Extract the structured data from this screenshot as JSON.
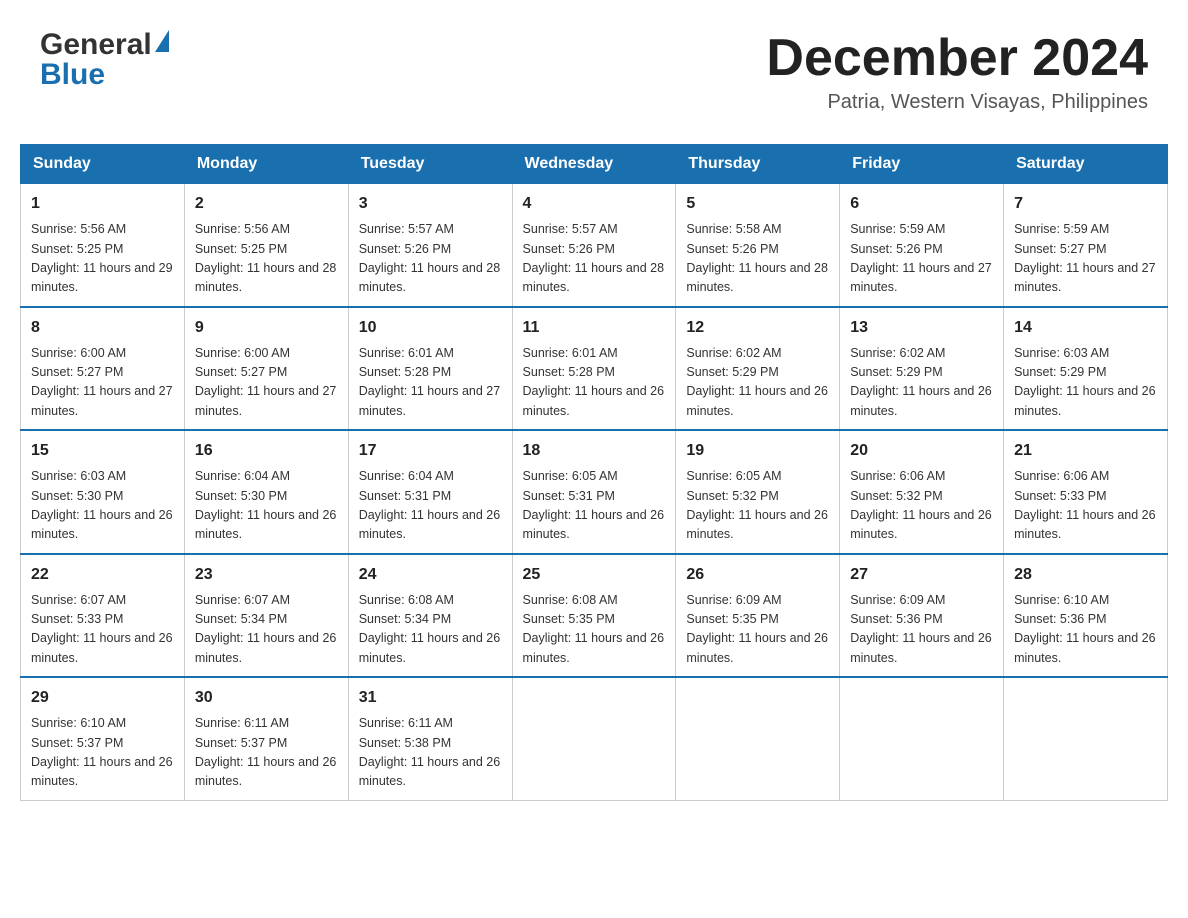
{
  "header": {
    "logo": {
      "general": "General",
      "blue": "Blue"
    },
    "title": "December 2024",
    "location": "Patria, Western Visayas, Philippines"
  },
  "calendar": {
    "days_of_week": [
      "Sunday",
      "Monday",
      "Tuesday",
      "Wednesday",
      "Thursday",
      "Friday",
      "Saturday"
    ],
    "weeks": [
      [
        {
          "day": "1",
          "sunrise": "Sunrise: 5:56 AM",
          "sunset": "Sunset: 5:25 PM",
          "daylight": "Daylight: 11 hours and 29 minutes."
        },
        {
          "day": "2",
          "sunrise": "Sunrise: 5:56 AM",
          "sunset": "Sunset: 5:25 PM",
          "daylight": "Daylight: 11 hours and 28 minutes."
        },
        {
          "day": "3",
          "sunrise": "Sunrise: 5:57 AM",
          "sunset": "Sunset: 5:26 PM",
          "daylight": "Daylight: 11 hours and 28 minutes."
        },
        {
          "day": "4",
          "sunrise": "Sunrise: 5:57 AM",
          "sunset": "Sunset: 5:26 PM",
          "daylight": "Daylight: 11 hours and 28 minutes."
        },
        {
          "day": "5",
          "sunrise": "Sunrise: 5:58 AM",
          "sunset": "Sunset: 5:26 PM",
          "daylight": "Daylight: 11 hours and 28 minutes."
        },
        {
          "day": "6",
          "sunrise": "Sunrise: 5:59 AM",
          "sunset": "Sunset: 5:26 PM",
          "daylight": "Daylight: 11 hours and 27 minutes."
        },
        {
          "day": "7",
          "sunrise": "Sunrise: 5:59 AM",
          "sunset": "Sunset: 5:27 PM",
          "daylight": "Daylight: 11 hours and 27 minutes."
        }
      ],
      [
        {
          "day": "8",
          "sunrise": "Sunrise: 6:00 AM",
          "sunset": "Sunset: 5:27 PM",
          "daylight": "Daylight: 11 hours and 27 minutes."
        },
        {
          "day": "9",
          "sunrise": "Sunrise: 6:00 AM",
          "sunset": "Sunset: 5:27 PM",
          "daylight": "Daylight: 11 hours and 27 minutes."
        },
        {
          "day": "10",
          "sunrise": "Sunrise: 6:01 AM",
          "sunset": "Sunset: 5:28 PM",
          "daylight": "Daylight: 11 hours and 27 minutes."
        },
        {
          "day": "11",
          "sunrise": "Sunrise: 6:01 AM",
          "sunset": "Sunset: 5:28 PM",
          "daylight": "Daylight: 11 hours and 26 minutes."
        },
        {
          "day": "12",
          "sunrise": "Sunrise: 6:02 AM",
          "sunset": "Sunset: 5:29 PM",
          "daylight": "Daylight: 11 hours and 26 minutes."
        },
        {
          "day": "13",
          "sunrise": "Sunrise: 6:02 AM",
          "sunset": "Sunset: 5:29 PM",
          "daylight": "Daylight: 11 hours and 26 minutes."
        },
        {
          "day": "14",
          "sunrise": "Sunrise: 6:03 AM",
          "sunset": "Sunset: 5:29 PM",
          "daylight": "Daylight: 11 hours and 26 minutes."
        }
      ],
      [
        {
          "day": "15",
          "sunrise": "Sunrise: 6:03 AM",
          "sunset": "Sunset: 5:30 PM",
          "daylight": "Daylight: 11 hours and 26 minutes."
        },
        {
          "day": "16",
          "sunrise": "Sunrise: 6:04 AM",
          "sunset": "Sunset: 5:30 PM",
          "daylight": "Daylight: 11 hours and 26 minutes."
        },
        {
          "day": "17",
          "sunrise": "Sunrise: 6:04 AM",
          "sunset": "Sunset: 5:31 PM",
          "daylight": "Daylight: 11 hours and 26 minutes."
        },
        {
          "day": "18",
          "sunrise": "Sunrise: 6:05 AM",
          "sunset": "Sunset: 5:31 PM",
          "daylight": "Daylight: 11 hours and 26 minutes."
        },
        {
          "day": "19",
          "sunrise": "Sunrise: 6:05 AM",
          "sunset": "Sunset: 5:32 PM",
          "daylight": "Daylight: 11 hours and 26 minutes."
        },
        {
          "day": "20",
          "sunrise": "Sunrise: 6:06 AM",
          "sunset": "Sunset: 5:32 PM",
          "daylight": "Daylight: 11 hours and 26 minutes."
        },
        {
          "day": "21",
          "sunrise": "Sunrise: 6:06 AM",
          "sunset": "Sunset: 5:33 PM",
          "daylight": "Daylight: 11 hours and 26 minutes."
        }
      ],
      [
        {
          "day": "22",
          "sunrise": "Sunrise: 6:07 AM",
          "sunset": "Sunset: 5:33 PM",
          "daylight": "Daylight: 11 hours and 26 minutes."
        },
        {
          "day": "23",
          "sunrise": "Sunrise: 6:07 AM",
          "sunset": "Sunset: 5:34 PM",
          "daylight": "Daylight: 11 hours and 26 minutes."
        },
        {
          "day": "24",
          "sunrise": "Sunrise: 6:08 AM",
          "sunset": "Sunset: 5:34 PM",
          "daylight": "Daylight: 11 hours and 26 minutes."
        },
        {
          "day": "25",
          "sunrise": "Sunrise: 6:08 AM",
          "sunset": "Sunset: 5:35 PM",
          "daylight": "Daylight: 11 hours and 26 minutes."
        },
        {
          "day": "26",
          "sunrise": "Sunrise: 6:09 AM",
          "sunset": "Sunset: 5:35 PM",
          "daylight": "Daylight: 11 hours and 26 minutes."
        },
        {
          "day": "27",
          "sunrise": "Sunrise: 6:09 AM",
          "sunset": "Sunset: 5:36 PM",
          "daylight": "Daylight: 11 hours and 26 minutes."
        },
        {
          "day": "28",
          "sunrise": "Sunrise: 6:10 AM",
          "sunset": "Sunset: 5:36 PM",
          "daylight": "Daylight: 11 hours and 26 minutes."
        }
      ],
      [
        {
          "day": "29",
          "sunrise": "Sunrise: 6:10 AM",
          "sunset": "Sunset: 5:37 PM",
          "daylight": "Daylight: 11 hours and 26 minutes."
        },
        {
          "day": "30",
          "sunrise": "Sunrise: 6:11 AM",
          "sunset": "Sunset: 5:37 PM",
          "daylight": "Daylight: 11 hours and 26 minutes."
        },
        {
          "day": "31",
          "sunrise": "Sunrise: 6:11 AM",
          "sunset": "Sunset: 5:38 PM",
          "daylight": "Daylight: 11 hours and 26 minutes."
        },
        null,
        null,
        null,
        null
      ]
    ]
  }
}
